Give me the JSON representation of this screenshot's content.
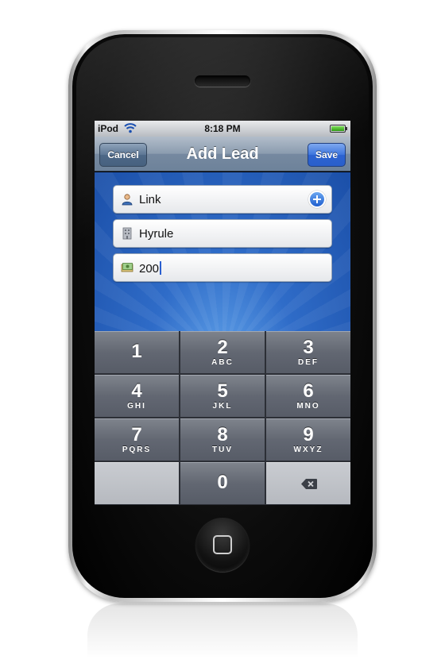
{
  "status_bar": {
    "carrier": "iPod",
    "time": "8:18 PM",
    "wifi_icon": "wifi-icon",
    "battery_icon": "battery-full-icon"
  },
  "nav_bar": {
    "title": "Add Lead",
    "cancel_label": "Cancel",
    "save_label": "Save"
  },
  "form": {
    "fields": [
      {
        "icon": "person-icon",
        "value": "Link",
        "accessory_icon": "add-icon"
      },
      {
        "icon": "building-icon",
        "value": "Hyrule"
      },
      {
        "icon": "money-icon",
        "value": "200"
      }
    ]
  },
  "keypad": {
    "keys": [
      {
        "digit": "1",
        "letters": ""
      },
      {
        "digit": "2",
        "letters": "ABC"
      },
      {
        "digit": "3",
        "letters": "DEF"
      },
      {
        "digit": "4",
        "letters": "GHI"
      },
      {
        "digit": "5",
        "letters": "JKL"
      },
      {
        "digit": "6",
        "letters": "MNO"
      },
      {
        "digit": "7",
        "letters": "PQRS"
      },
      {
        "digit": "8",
        "letters": "TUV"
      },
      {
        "digit": "9",
        "letters": "WXYZ"
      },
      {
        "digit": "0",
        "letters": ""
      }
    ],
    "delete_icon": "backspace-icon"
  },
  "colors": {
    "nav_bar": "#7f92a8",
    "save_button": "#2f66d4",
    "background_blue": "#2f6cc8",
    "caret": "#2a5fd0"
  }
}
